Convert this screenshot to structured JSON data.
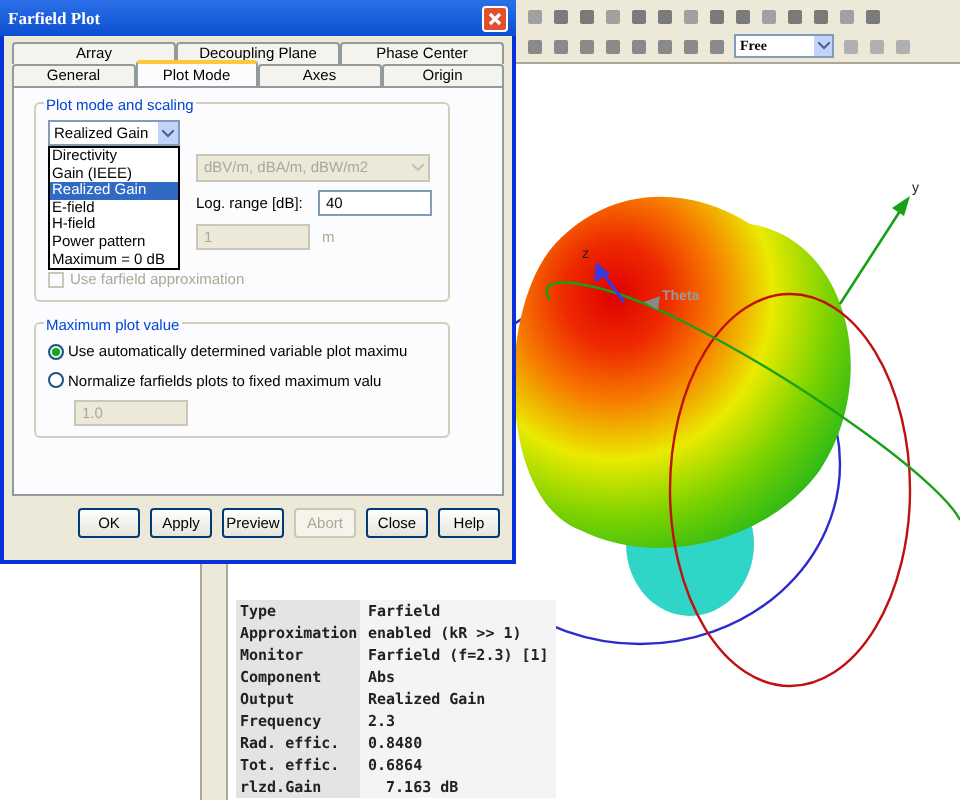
{
  "dialog": {
    "title": "Farfield Plot",
    "tab_rows": [
      [
        {
          "label": "Array",
          "selected": false
        },
        {
          "label": "Decoupling Plane",
          "selected": false
        },
        {
          "label": "Phase Center",
          "selected": false
        }
      ],
      [
        {
          "label": "General",
          "selected": false
        },
        {
          "label": "Plot Mode",
          "selected": true
        },
        {
          "label": "Axes",
          "selected": false
        },
        {
          "label": "Origin",
          "selected": false
        }
      ]
    ],
    "scaling_group": {
      "title": "Plot mode and scaling",
      "mode_select": {
        "value": "Realized Gain",
        "expanded": true,
        "options": [
          {
            "label": "Directivity",
            "selected": false
          },
          {
            "label": "Gain (IEEE)",
            "selected": false
          },
          {
            "label": "Realized Gain",
            "selected": true
          },
          {
            "label": "E-field",
            "selected": false
          },
          {
            "label": "H-field",
            "selected": false
          },
          {
            "label": "Power pattern",
            "selected": false
          },
          {
            "label": "Maximum = 0 dB",
            "selected": false
          }
        ]
      },
      "unit_select": {
        "value": "dBV/m, dBA/m, dBW/m2",
        "disabled": true
      },
      "log_range": {
        "label": "Log. range [dB]:",
        "value": "40"
      },
      "distance": {
        "value": "1",
        "unit": "m",
        "disabled": true
      },
      "farfield_approximation": {
        "label": "Use farfield approximation",
        "checked": false,
        "disabled": true
      }
    },
    "maximum_group": {
      "title": "Maximum plot value",
      "options": [
        {
          "label": "Use automatically determined variable plot maximu",
          "selected": true
        },
        {
          "label": "Normalize farfields plots to fixed maximum valu",
          "selected": false
        }
      ],
      "fixed_value": {
        "value": "1.0",
        "disabled": true
      }
    },
    "buttons": [
      {
        "label": "OK",
        "disabled": false
      },
      {
        "label": "Apply",
        "disabled": false
      },
      {
        "label": "Preview",
        "disabled": false
      },
      {
        "label": "Abort",
        "disabled": true
      },
      {
        "label": "Close",
        "disabled": false
      },
      {
        "label": "Help",
        "disabled": false
      }
    ]
  },
  "toolbar": {
    "view_select": {
      "value": "Free"
    }
  },
  "plot": {
    "axis_labels": [
      "z",
      "y"
    ],
    "marker_label": "Theta"
  },
  "info_table": {
    "rows": [
      {
        "label": "Type",
        "value": "Farfield"
      },
      {
        "label": "Approximation",
        "value": "enabled (kR >> 1)"
      },
      {
        "label": "Monitor",
        "value": "Farfield (f=2.3) [1]"
      },
      {
        "label": "Component",
        "value": "Abs"
      },
      {
        "label": "Output",
        "value": "Realized Gain"
      },
      {
        "label": "Frequency",
        "value": "2.3"
      },
      {
        "label": "Rad. effic.",
        "value": "0.8480"
      },
      {
        "label": "Tot. effic.",
        "value": "0.6864"
      },
      {
        "label": "rlzd.Gain",
        "value": "  7.163 dB"
      }
    ]
  }
}
